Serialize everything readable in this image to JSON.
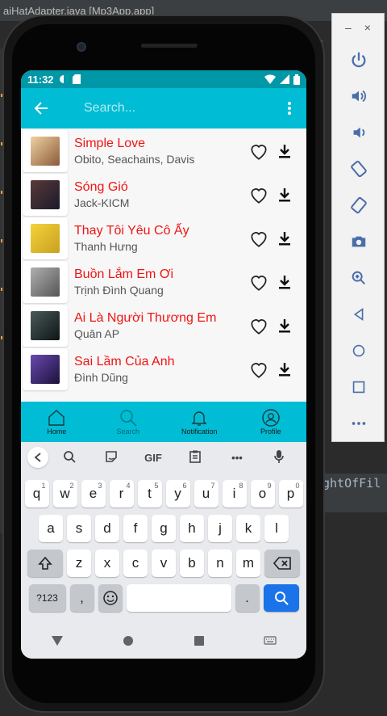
{
  "ide": {
    "title": "aiHatAdapter.java [Mp3App.app]",
    "code_snippet": "ghtOfFil"
  },
  "emulator_panel": {
    "minimize": "–",
    "close": "×",
    "tools": [
      "power-icon",
      "volume-up-icon",
      "volume-down-icon",
      "rotate-left-icon",
      "rotate-right-icon",
      "camera-icon",
      "zoom-icon",
      "back-icon",
      "home-icon",
      "overview-icon",
      "more-icon"
    ]
  },
  "status_bar": {
    "time": "11:32"
  },
  "app_bar": {
    "search_placeholder": "Search..."
  },
  "songs": [
    {
      "title": "Simple Love",
      "artist": "Obito, Seachains, Davis",
      "thumb_color": "#c9a27a"
    },
    {
      "title": "Sóng Gió",
      "artist": "Jack-KICM",
      "thumb_color": "#3a2a2a"
    },
    {
      "title": "Thay Tôi Yêu Cô Ấy",
      "artist": "Thanh Hưng",
      "thumb_color": "#e8c33a"
    },
    {
      "title": "Buồn Lắm Em Ơi",
      "artist": "Trịnh Đình Quang",
      "thumb_color": "#8a8a8a"
    },
    {
      "title": "Ai Là Người Thương Em",
      "artist": "Quân AP",
      "thumb_color": "#1e2a2a"
    },
    {
      "title": "Sai Lầm Của Anh",
      "artist": "Đình Dũng",
      "thumb_color": "#3a2a6a"
    }
  ],
  "bottom_nav": {
    "home": "Home",
    "search": "Search",
    "notification": "Notification",
    "profile": "Profile"
  },
  "keyboard": {
    "toolbar": {
      "gif": "GIF",
      "more": "•••"
    },
    "row1": [
      [
        "q",
        "1"
      ],
      [
        "w",
        "2"
      ],
      [
        "e",
        "3"
      ],
      [
        "r",
        "4"
      ],
      [
        "t",
        "5"
      ],
      [
        "y",
        "6"
      ],
      [
        "u",
        "7"
      ],
      [
        "i",
        "8"
      ],
      [
        "o",
        "9"
      ],
      [
        "p",
        "0"
      ]
    ],
    "row2": [
      "a",
      "s",
      "d",
      "f",
      "g",
      "h",
      "j",
      "k",
      "l"
    ],
    "row3": [
      "z",
      "x",
      "c",
      "v",
      "b",
      "n",
      "m"
    ],
    "sym_label": "?123",
    "comma": ",",
    "period": "."
  },
  "colors": {
    "app_bar": "#00bcd4",
    "status_bar": "#0097a7",
    "song_title": "#f01414",
    "enter_key": "#1a73e8"
  }
}
